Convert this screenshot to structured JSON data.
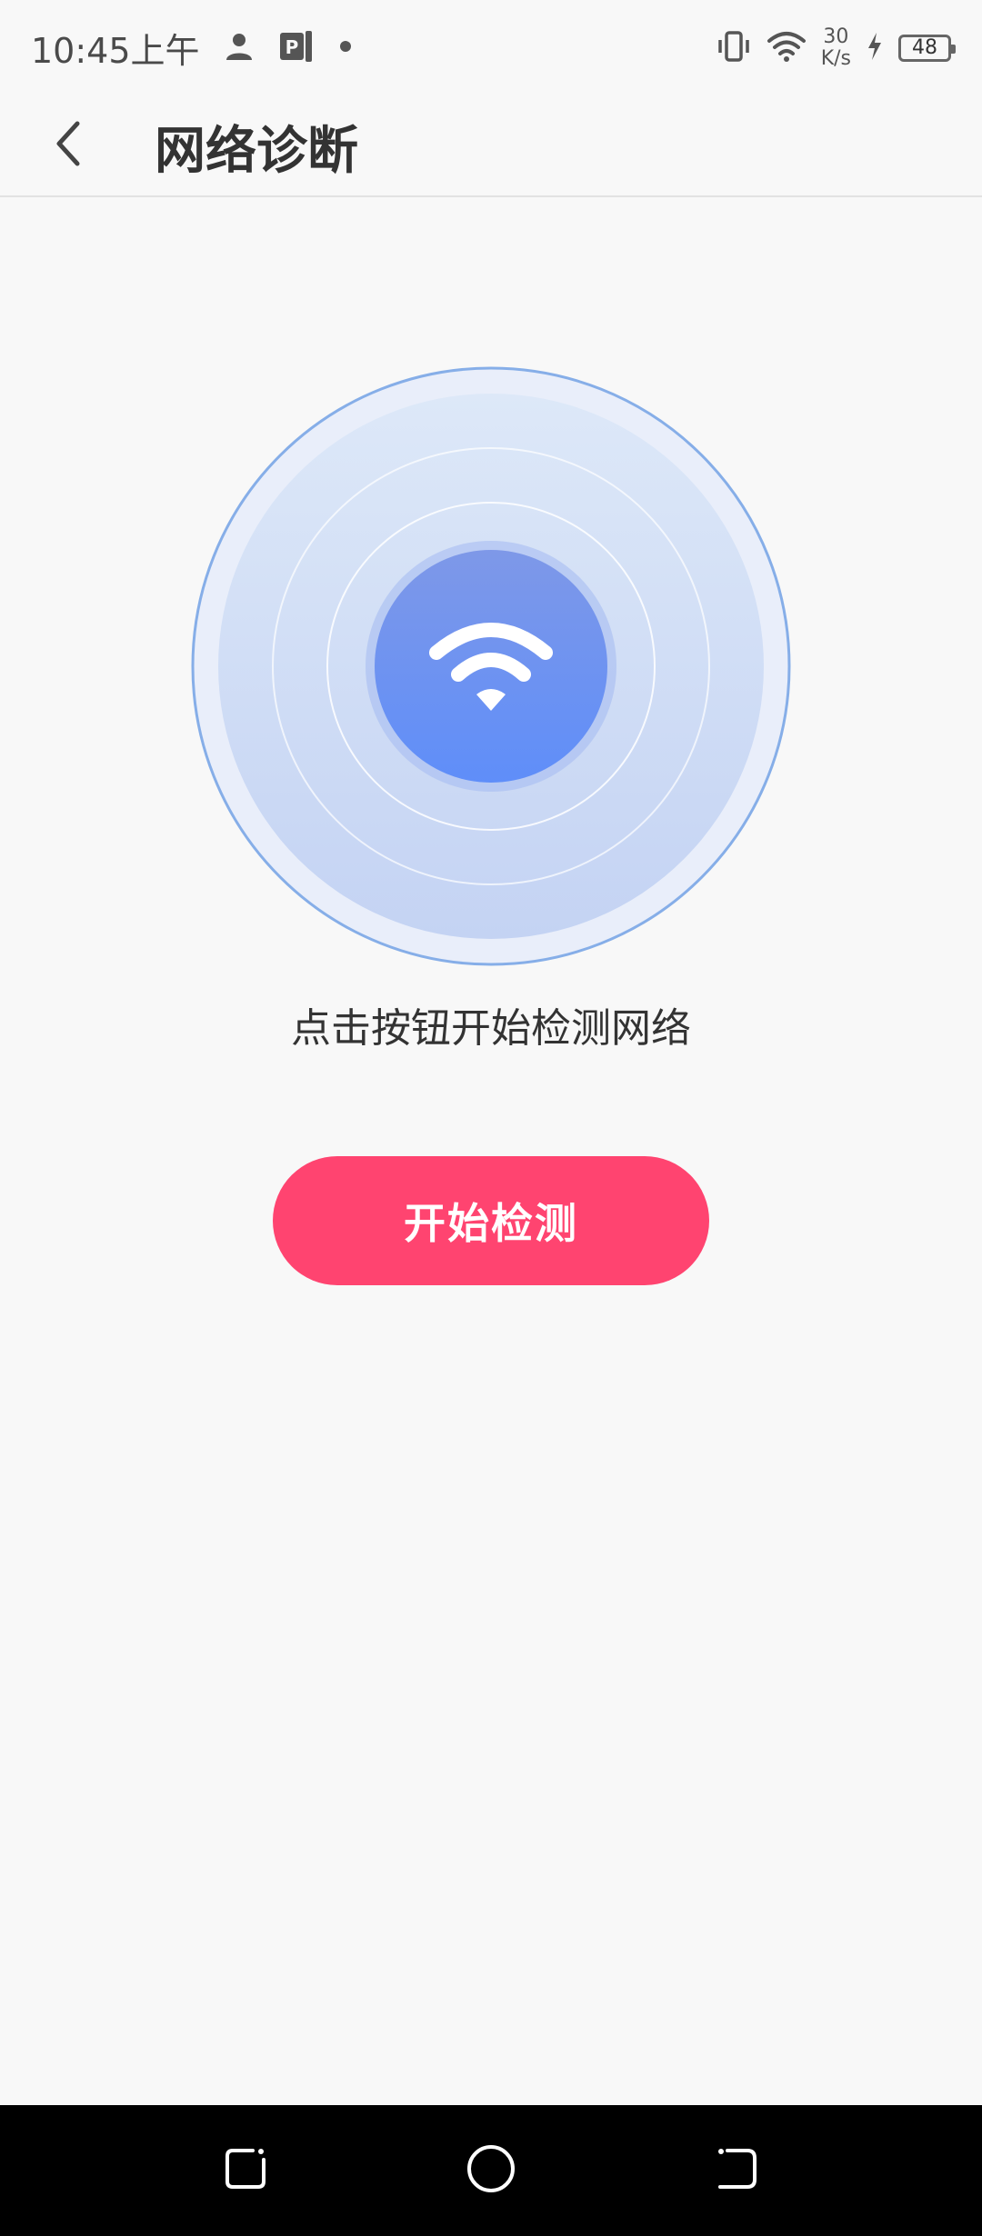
{
  "status_bar": {
    "time": "10:45上午",
    "net_speed_value": "30",
    "net_speed_unit": "K/s",
    "battery_level": "48",
    "icons": [
      "person-icon",
      "parking-app-icon",
      "dot-icon",
      "vibrate-icon",
      "wifi-icon",
      "charging-icon",
      "battery-icon"
    ]
  },
  "app_bar": {
    "title": "网络诊断",
    "back_icon": "chevron-left-icon"
  },
  "main": {
    "hint": "点击按钮开始检测网络",
    "start_button_label": "开始检测",
    "center_icon": "wifi-icon"
  },
  "colors": {
    "accent": "#ff4470",
    "radar_center": "#6f93f2",
    "radar_ring": "#7fa8ea",
    "background": "#f8f8f8"
  },
  "nav_bar": {
    "icons": [
      "recent-apps-icon",
      "home-icon",
      "back-icon"
    ]
  }
}
